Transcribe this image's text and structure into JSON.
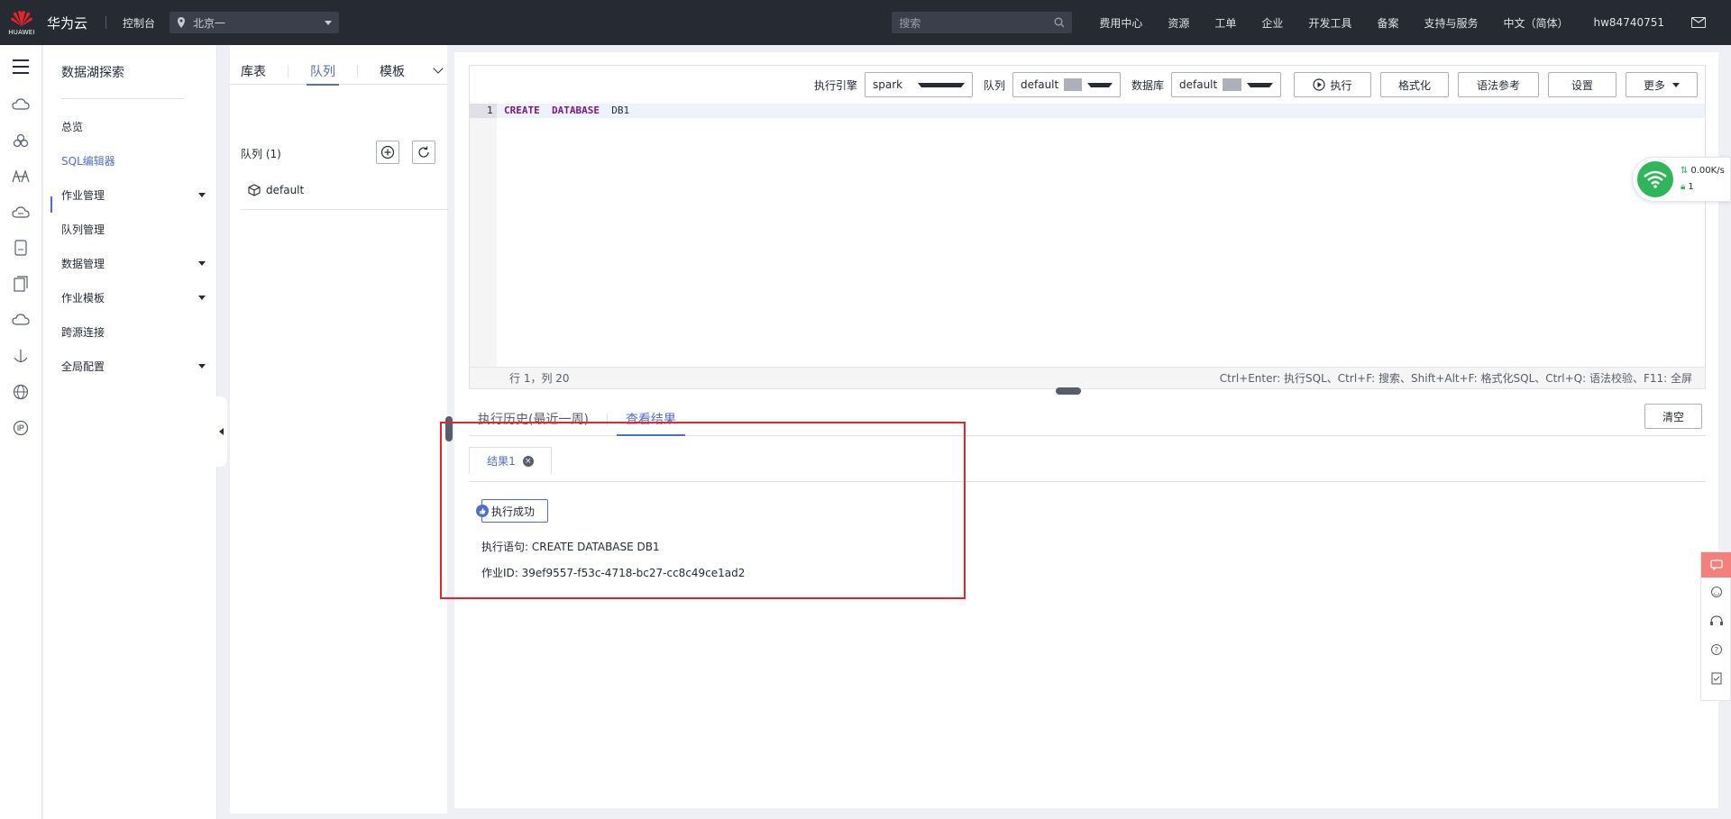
{
  "topbar": {
    "logo_small": "HUAWEI",
    "brand": "华为云",
    "console": "控制台",
    "region": "北京一",
    "search_placeholder": "搜索",
    "nav": [
      "费用中心",
      "资源",
      "工单",
      "企业",
      "开发工具",
      "备案",
      "支持与服务",
      "中文（简体）",
      "hw84740751"
    ]
  },
  "subnav": {
    "title": "数据湖探索",
    "items": [
      {
        "label": "总览"
      },
      {
        "label": "SQL编辑器"
      },
      {
        "label": "作业管理"
      },
      {
        "label": "队列管理"
      },
      {
        "label": "数据管理"
      },
      {
        "label": "作业模板"
      },
      {
        "label": "跨源连接"
      },
      {
        "label": "全局配置"
      }
    ]
  },
  "leftpanel": {
    "tabs": [
      "库表",
      "队列",
      "模板"
    ],
    "queue_header": "队列 (1)",
    "queue_item": "default"
  },
  "toolbar": {
    "engine_label": "执行引擎",
    "engine_value": "spark",
    "queue_label": "队列",
    "queue_value": "default",
    "db_label": "数据库",
    "db_value": "default",
    "run": "执行",
    "format": "格式化",
    "syntax": "语法参考",
    "settings": "设置",
    "more": "更多"
  },
  "editor": {
    "line_number": "1",
    "kw1": "CREATE",
    "kw2": "DATABASE",
    "ident": "DB1",
    "cursor": "行 1，列 20",
    "shortcuts": "Ctrl+Enter: 执行SQL、Ctrl+F: 搜索、Shift+Alt+F: 格式化SQL、Ctrl+Q: 语法校验、F11: 全屏"
  },
  "results": {
    "tabs": [
      "执行历史(最近一周)",
      "查看结果"
    ],
    "clear": "清空",
    "result_tab": "结果1",
    "status": "执行成功",
    "statement": "执行语句: CREATE DATABASE DB1",
    "job_id": "作业ID: 39ef9557-f53c-4718-bc27-cc8c49ce1ad2"
  },
  "network": {
    "speed": "0.00K/s",
    "count": "1"
  },
  "colors": {
    "accent": "#526ecc",
    "topbar": "#252a33",
    "highlight": "#e8232a",
    "wifi": "#2fb55c"
  }
}
